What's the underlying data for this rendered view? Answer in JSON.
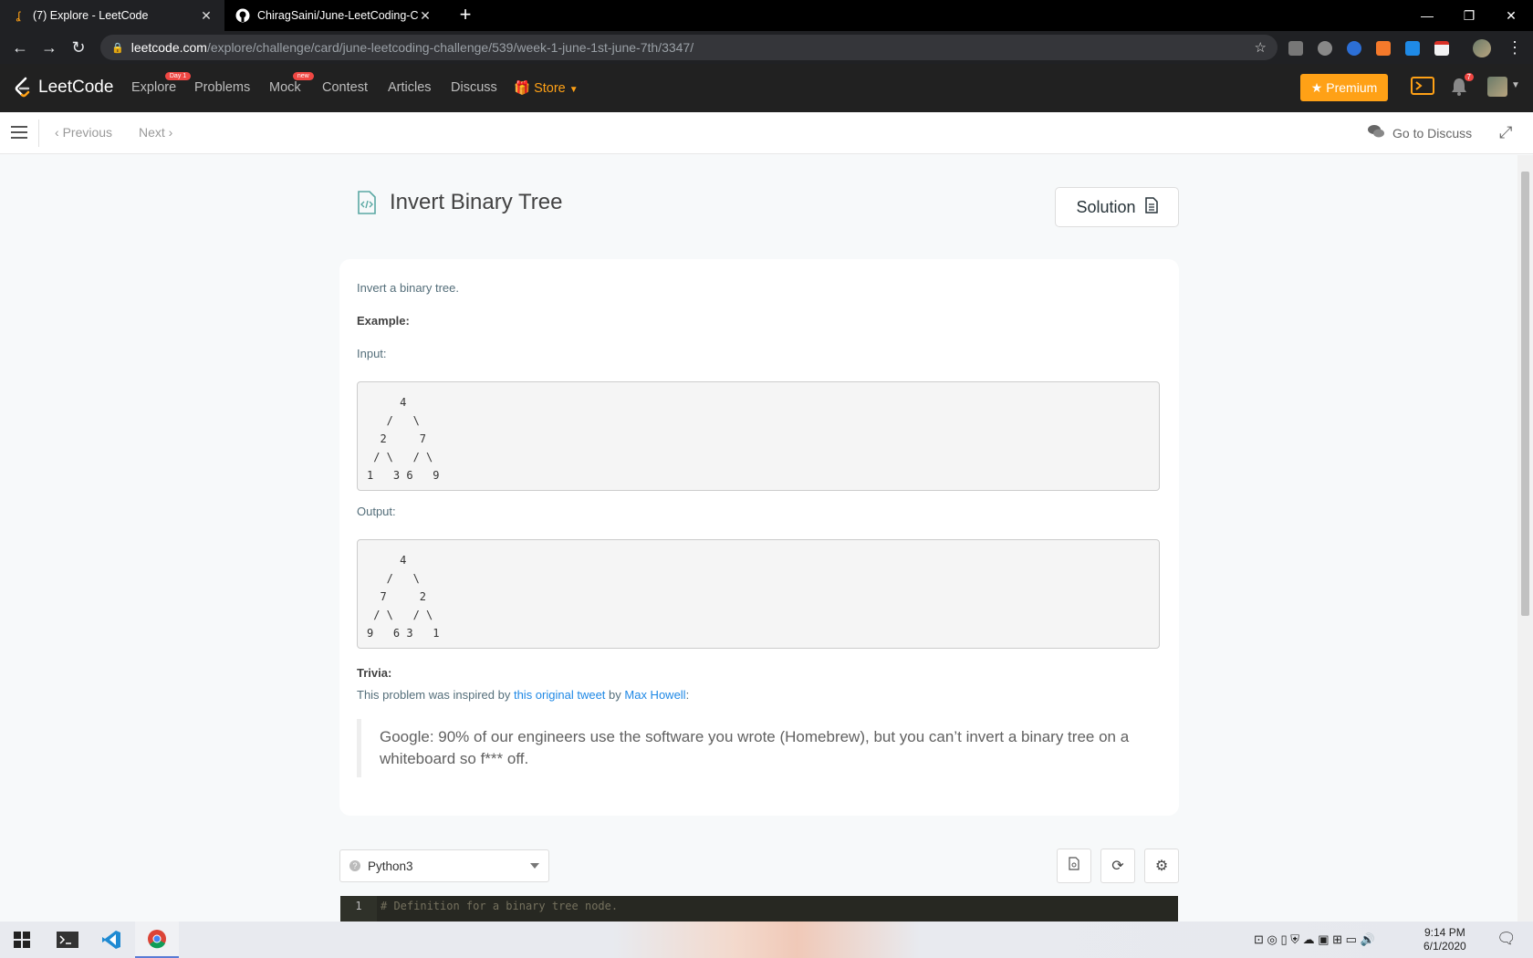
{
  "browser": {
    "tabs": [
      {
        "title": "(7) Explore - LeetCode",
        "active": true
      },
      {
        "title": "ChiragSaini/June-LeetCoding-Ch",
        "active": false
      }
    ],
    "url_host": "leetcode.com",
    "url_path": "/explore/challenge/card/june-leetcoding-challenge/539/week-1-june-1st-june-7th/3347/"
  },
  "navbar": {
    "logo_text": "LeetCode",
    "items": [
      {
        "label": "Explore",
        "badge": "Day 1"
      },
      {
        "label": "Problems"
      },
      {
        "label": "Mock",
        "badge": "new"
      },
      {
        "label": "Contest"
      },
      {
        "label": "Articles"
      },
      {
        "label": "Discuss"
      },
      {
        "label": "Store"
      }
    ],
    "premium_label": "Premium",
    "notification_count": "7",
    "accent_color": "#ffa116"
  },
  "subnav": {
    "previous_label": "Previous",
    "next_label": "Next",
    "discuss_label": "Go to Discuss"
  },
  "question": {
    "title": "Invert Binary Tree",
    "solution_label": "Solution",
    "description": "Invert a binary tree.",
    "example_label": "Example:",
    "input_label": "Input:",
    "input_tree": "     4\n   /   \\\n  2     7\n / \\   / \\\n1   3 6   9",
    "output_label": "Output:",
    "output_tree": "     4\n   /   \\\n  7     2\n / \\   / \\\n9   6 3   1",
    "trivia_label": "Trivia:",
    "trivia_prefix": "This problem was inspired by ",
    "trivia_link1": "this original tweet",
    "trivia_mid": " by ",
    "trivia_link2": "Max Howell",
    "trivia_suffix": ":",
    "quote": "Google: 90% of our engineers use the software you wrote (Homebrew), but you can’t invert a binary tree on a whiteboard so f*** off."
  },
  "editor": {
    "language": "Python3",
    "line_number": "1",
    "first_line": "# Definition for a binary tree node."
  },
  "taskbar": {
    "time": "9:14 PM",
    "date": "6/1/2020"
  }
}
